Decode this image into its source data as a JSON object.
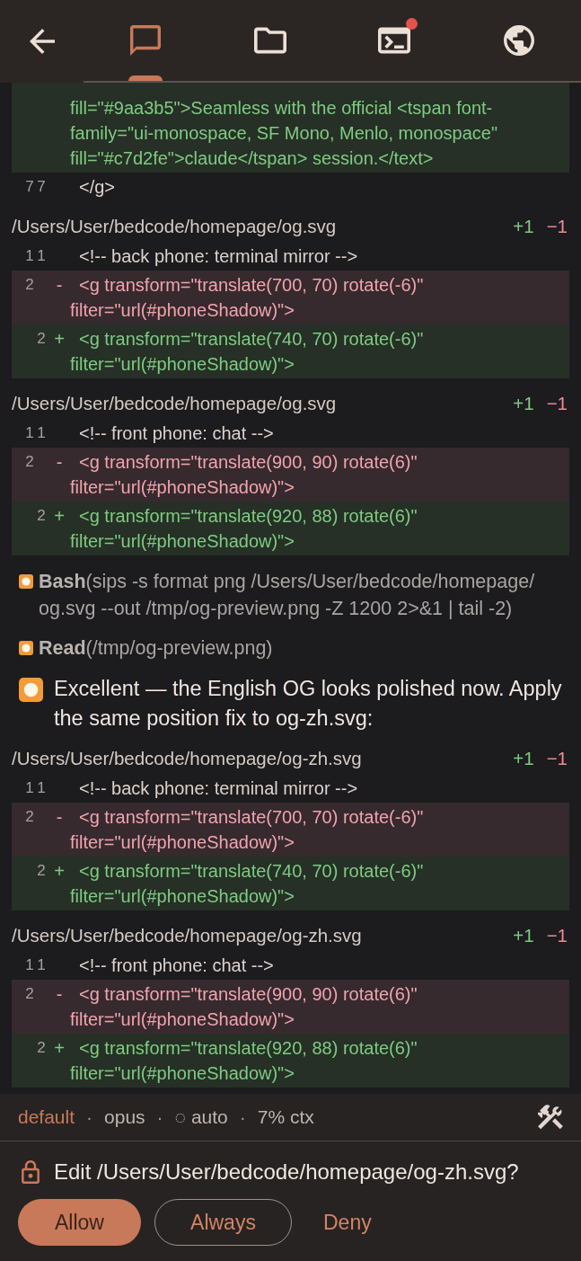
{
  "nav": {
    "tabs": [
      {
        "selected": true,
        "badge": false
      },
      {
        "selected": false,
        "badge": false
      },
      {
        "selected": false,
        "badge": true
      },
      {
        "selected": false,
        "badge": false
      }
    ]
  },
  "transcript": [
    {
      "kind": "diff",
      "lines": [
        {
          "kind": "added",
          "text": "fill=\"#9aa3b5\">Seamless with the official <tspan font-family=\"ui-monospace, SF Mono, Menlo, monospace\" fill=\"#c7d2fe\">claude</tspan> session.</text>"
        },
        {
          "kind": "context",
          "old": "7",
          "new": "7",
          "text": "</g>"
        }
      ]
    },
    {
      "kind": "diff",
      "file": "/Users/User/bedcode/homepage/og.svg",
      "added": "+1",
      "removed": "−1",
      "lines": [
        {
          "kind": "context",
          "old": "1",
          "new": "1",
          "text": "<!-- back phone: terminal mirror -->"
        },
        {
          "kind": "removed",
          "old": "2",
          "sign": "-",
          "text": "<g transform=\"translate(700, 70) rotate(-6)\" filter=\"url(#phoneShadow)\">"
        },
        {
          "kind": "added",
          "new": "2",
          "sign": "+",
          "text": "<g transform=\"translate(740, 70) rotate(-6)\" filter=\"url(#phoneShadow)\">"
        }
      ]
    },
    {
      "kind": "diff",
      "file": "/Users/User/bedcode/homepage/og.svg",
      "added": "+1",
      "removed": "−1",
      "lines": [
        {
          "kind": "context",
          "old": "1",
          "new": "1",
          "text": "<!-- front phone: chat -->"
        },
        {
          "kind": "removed",
          "old": "2",
          "sign": "-",
          "text": "<g transform=\"translate(900, 90) rotate(6)\" filter=\"url(#phoneShadow)\">"
        },
        {
          "kind": "added",
          "new": "2",
          "sign": "+",
          "text": "<g transform=\"translate(920, 88) rotate(6)\" filter=\"url(#phoneShadow)\">"
        }
      ]
    },
    {
      "kind": "tool",
      "text": "**Bash**(sips -s format png /Users/User/bedcode/homepage/og.svg --out /tmp/og-preview.png -Z 1200 2>&1 | tail -2)"
    },
    {
      "kind": "tool",
      "text": "**Read**(/tmp/og-preview.png)"
    },
    {
      "kind": "message",
      "text": "Excellent — the English OG looks polished now. Apply the same position fix to og-zh.svg:"
    },
    {
      "kind": "diff",
      "file": "/Users/User/bedcode/homepage/og-zh.svg",
      "added": "+1",
      "removed": "−1",
      "lines": [
        {
          "kind": "context",
          "old": "1",
          "new": "1",
          "text": "<!-- back phone: terminal mirror -->"
        },
        {
          "kind": "removed",
          "old": "2",
          "sign": "-",
          "text": "<g transform=\"translate(700, 70) rotate(-6)\" filter=\"url(#phoneShadow)\">"
        },
        {
          "kind": "added",
          "new": "2",
          "sign": "+",
          "text": "<g transform=\"translate(740, 70) rotate(-6)\" filter=\"url(#phoneShadow)\">"
        }
      ]
    },
    {
      "kind": "diff",
      "file": "/Users/User/bedcode/homepage/og-zh.svg",
      "added": "+1",
      "removed": "−1",
      "lines": [
        {
          "kind": "context",
          "old": "1",
          "new": "1",
          "text": "<!-- front phone: chat -->"
        },
        {
          "kind": "removed",
          "old": "2",
          "sign": "-",
          "text": "<g transform=\"translate(900, 90) rotate(6)\" filter=\"url(#phoneShadow)\">"
        },
        {
          "kind": "added",
          "new": "2",
          "sign": "+",
          "text": "<g transform=\"translate(920, 88) rotate(6)\" filter=\"url(#phoneShadow)\">"
        }
      ]
    }
  ],
  "status_bar": {
    "items": [
      {
        "kind": "mode",
        "text": "default"
      },
      {
        "kind": "sep",
        "text": "·"
      },
      {
        "kind": "info",
        "text": "opus"
      },
      {
        "kind": "sep",
        "text": "·"
      },
      {
        "kind": "info",
        "text": "◌ auto"
      },
      {
        "kind": "sep",
        "text": "·"
      },
      {
        "kind": "info",
        "text": "7% ctx"
      }
    ]
  },
  "permission": {
    "prompt": "Edit /Users/User/bedcode/homepage/og-zh.svg?",
    "buttons": [
      {
        "kind": "primary",
        "label": "Allow"
      },
      {
        "kind": "outline",
        "label": "Always"
      },
      {
        "kind": "text",
        "label": "Deny"
      }
    ]
  }
}
